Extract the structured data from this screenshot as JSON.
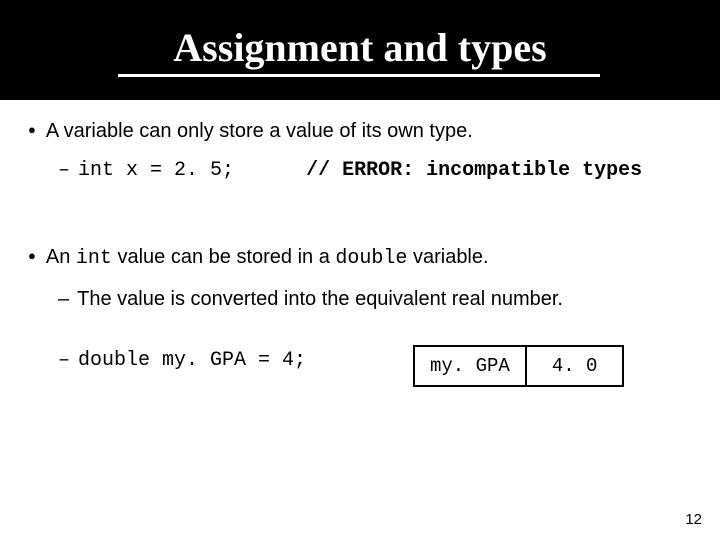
{
  "title": "Assignment and types",
  "bullets": {
    "b1": "A variable can only store a value of its own type.",
    "b1_code": "int x = 2. 5;",
    "b1_comment": "// ERROR: incompatible types",
    "b2_pre": "An ",
    "b2_code1": "int",
    "b2_mid": " value can be stored in a ",
    "b2_code2": "double",
    "b2_post": " variable.",
    "b2_sub": "The value is converted into the equivalent real number.",
    "b2_code_line": "double my. GPA = 4;"
  },
  "box": {
    "label": "my. GPA",
    "value": "4. 0"
  },
  "page_number": "12"
}
